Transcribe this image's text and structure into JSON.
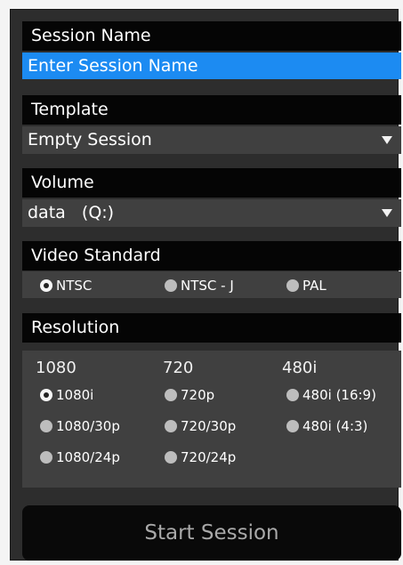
{
  "session_name": {
    "label": "Session Name",
    "placeholder": "Enter Session Name"
  },
  "template": {
    "label": "Template",
    "selected": "Empty Session"
  },
  "volume": {
    "label": "Volume",
    "selected": "data   (Q:)"
  },
  "video_standard": {
    "label": "Video Standard",
    "options": [
      "NTSC",
      "NTSC - J",
      "PAL"
    ],
    "selected": "NTSC"
  },
  "resolution": {
    "label": "Resolution",
    "columns": [
      {
        "header": "1080",
        "options": [
          "1080i",
          "1080/30p",
          "1080/24p"
        ]
      },
      {
        "header": "720",
        "options": [
          "720p",
          "720/30p",
          "720/24p"
        ]
      },
      {
        "header": "480i",
        "options": [
          "480i (16:9)",
          "480i (4:3)"
        ]
      }
    ],
    "selected": "1080i"
  },
  "start_button": "Start Session"
}
